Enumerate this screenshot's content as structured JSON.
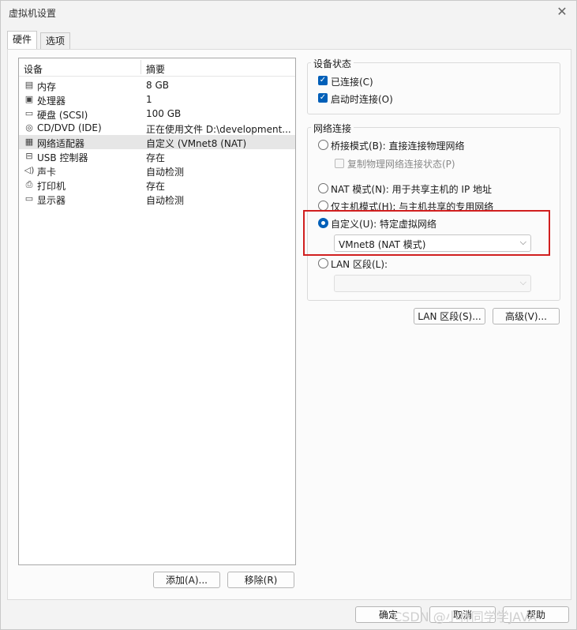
{
  "window": {
    "title": "虚拟机设置",
    "close_icon": "close-icon"
  },
  "tabs": [
    {
      "label": "硬件"
    },
    {
      "label": "选项"
    }
  ],
  "device_list": {
    "headers": {
      "device": "设备",
      "summary": "摘要"
    },
    "rows": [
      {
        "name": "内存",
        "summary": "8 GB",
        "icon": "memory-icon"
      },
      {
        "name": "处理器",
        "summary": "1",
        "icon": "cpu-icon"
      },
      {
        "name": "硬盘 (SCSI)",
        "summary": "100 GB",
        "icon": "hard-disk-icon"
      },
      {
        "name": "CD/DVD (IDE)",
        "summary": "正在使用文件 D:\\development...",
        "icon": "cd-dvd-icon"
      },
      {
        "name": "网络适配器",
        "summary": "自定义 (VMnet8 (NAT)",
        "icon": "network-adapter-icon",
        "selected": true
      },
      {
        "name": "USB 控制器",
        "summary": "存在",
        "icon": "usb-icon"
      },
      {
        "name": "声卡",
        "summary": "自动检测",
        "icon": "speaker-icon"
      },
      {
        "name": "打印机",
        "summary": "存在",
        "icon": "printer-icon"
      },
      {
        "name": "显示器",
        "summary": "自动检测",
        "icon": "monitor-icon"
      }
    ]
  },
  "list_buttons": {
    "add": "添加(A)...",
    "remove": "移除(R)"
  },
  "device_status": {
    "title": "设备状态",
    "connected": {
      "label": "已连接(C)",
      "checked": true
    },
    "connect_at_power_on": {
      "label": "启动时连接(O)",
      "checked": true
    }
  },
  "network_connection": {
    "title": "网络连接",
    "bridged": {
      "label": "桥接模式(B): 直接连接物理网络",
      "selected": false
    },
    "replicate": {
      "label": "复制物理网络连接状态(P)",
      "checked": false
    },
    "nat": {
      "label": "NAT 模式(N): 用于共享主机的 IP 地址",
      "selected": false
    },
    "host_only": {
      "label": "仅主机模式(H): 与主机共享的专用网络",
      "selected": false
    },
    "custom": {
      "label": "自定义(U): 特定虚拟网络",
      "selected": true
    },
    "custom_value": "VMnet8 (NAT 模式)",
    "lan_segment": {
      "label": "LAN 区段(L):",
      "selected": false
    },
    "lan_value": ""
  },
  "network_buttons": {
    "lan_segments": "LAN 区段(S)...",
    "advanced": "高级(V)..."
  },
  "footer_buttons": {
    "ok": "确定",
    "cancel": "取消",
    "help": "帮助"
  },
  "watermark": "CSDN @小林同学学JAVA",
  "colors": {
    "accent": "#005fb8",
    "highlight_box": "#d11f1f",
    "selected_row": "#e6e6e6"
  }
}
